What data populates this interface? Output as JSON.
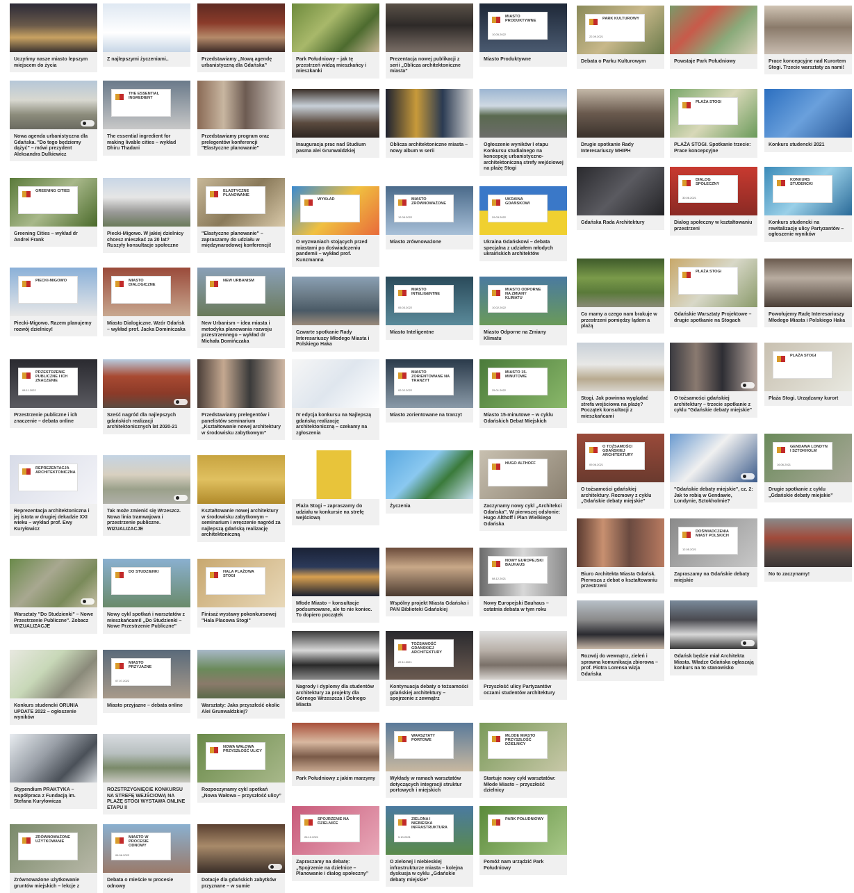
{
  "colors": {
    "card_bg": "#f0f0f0",
    "caption_text": "#2a2a2a",
    "accent_gold": "#d99c2b",
    "accent_red": "#c22a2a"
  },
  "cards": [
    {
      "caption": "Uczyńmy nasze miasto lepszym miejscem do życia",
      "thumb": "city-night"
    },
    {
      "caption": "Z najlepszymi życzeniami..",
      "thumb": "skyline-line"
    },
    {
      "caption": "Przedstawiamy „Nową agendę urbanistyczną dla Gdańska”",
      "thumb": "hall-red"
    },
    {
      "caption": "Park Południowy – jak tę przestrzeń widzą mieszkańcy i mieszkanki",
      "thumb": "greenery"
    },
    {
      "caption": "Prezentacja nowej publikacji z serii „Oblicza architektoniczne miasta”",
      "thumb": "audience"
    },
    {
      "caption": "Miasto Produktywne",
      "thumb": "badge-dark",
      "badge": "MIASTO PRODUKTYWNE",
      "date": "10.05.2022"
    },
    {
      "caption": "Debata o Parku Kulturowym",
      "thumb": "badge-aerial",
      "badge": "PARK KULTUROWY",
      "date": "22.09.2021"
    },
    {
      "caption": "Powstaje Park Południowy",
      "thumb": "map-red"
    },
    {
      "caption": "Prace koncepcyjne nad Kurortem Stogi. Trzecie warsztaty za nami!",
      "thumb": "workshop"
    },
    {
      "caption": "Nowa agenda urbanistyczna dla Gdańska. \"Do tego będziemy dążyć\" – mówi prezydent Aleksandra Dulkiewicz",
      "thumb": "street",
      "video": true
    },
    {
      "caption": "The essential ingredient for making livable cities – wykład Dhiru Thadani",
      "thumb": "badge-city",
      "badge": "THE ESSENTIAL INGREDIENT",
      "date": ""
    },
    {
      "caption": "Przedstawiamy program oraz prelegentów konferencji \"Elastyczne planowanie\"",
      "thumb": "portraits"
    },
    {
      "caption": "Inauguracja prac nad Studium pasma alei Grunwaldzkiej",
      "thumb": "presentation"
    },
    {
      "caption": "Oblicza architektoniczne miasta – nowy album w serii",
      "thumb": "books"
    },
    {
      "caption": "Ogłoszenie wyników I etapu Konkursu studialnego na koncepcję urbanistyczno-architektoniczną strefy wejściowej na plażę Stogi",
      "thumb": "road"
    },
    {
      "caption": "Drugie spotkanie Rady Interesariuszy MHIPH",
      "thumb": "meeting"
    },
    {
      "caption": "PLAŻA STOGI. Spotkanie trzecie: Prace koncepcyjne",
      "thumb": "badge-map",
      "badge": "PLAŻA STOGI",
      "date": ""
    },
    {
      "caption": "Konkurs studencki 2021",
      "thumb": "videocall-blue"
    },
    {
      "caption": "Greening Cities – wykład dr Andrei Frank",
      "thumb": "badge-trees",
      "badge": "GREENING CITIES",
      "date": ""
    },
    {
      "caption": "Piecki-Migowo. W jakiej dzielnicy chcesz mieszkać za 20 lat? Ruszyły konsultacje społeczne",
      "thumb": "blocks"
    },
    {
      "caption": "\"Elastyczne planowanie\" – zapraszamy do udziału w międzynarodowej konferencji!",
      "thumb": "badge-plan",
      "badge": "ELASTYCZNE PLANOWANIE",
      "date": ""
    },
    {
      "caption": "O wyzwaniach stojących przed miastami po doświadczeniu pandemii – wykład prof. Kunzmanna",
      "thumb": "badge-illustration",
      "badge": "WYKŁAD",
      "date": ""
    },
    {
      "caption": "Miasto zrównoważone",
      "thumb": "badge-hands",
      "badge": "MIASTO ZRÓWNOWAŻONE",
      "date": "12.05.2022"
    },
    {
      "caption": "Ukraina Gdańskowi – debata specjalna z udziałem młodych ukraińskich architektów",
      "thumb": "badge-ukraine",
      "badge": "UKRAINA GDAŃSKOWI",
      "date": "29.03.2022"
    },
    {
      "caption": "Gdańska Rada Architektury",
      "thumb": "videocall-dark"
    },
    {
      "caption": "Dialog społeczny w kształtowaniu przestrzeni",
      "thumb": "badge-red",
      "badge": "DIALOG SPOŁECZNY",
      "date": "30.06.2021"
    },
    {
      "caption": "Konkurs studencki na rewitalizację ulicy Partyzantów – ogłoszenie wyników",
      "thumb": "badge-blue-map",
      "badge": "KONKURS STUDENCKI",
      "date": ""
    },
    {
      "caption": "Piecki-Migowo. Razem planujemy rozwój dzielnicy!",
      "thumb": "badge-blocks",
      "badge": "PIECKI-MIGOWO",
      "date": ""
    },
    {
      "caption": "Miasto Dialogiczne. Wzór Gdańsk – wykład prof. Jacka Dominiczaka",
      "thumb": "badge-oldtown",
      "badge": "MIASTO DIALOGICZNE",
      "date": ""
    },
    {
      "caption": "New Urbanism – idea miasta i metodyka planowania rozwoju przestrzennego – wykład dr Michała Domińczaka",
      "thumb": "badge-harbour",
      "badge": "NEW URBANISM",
      "date": ""
    },
    {
      "caption": "Czwarte spotkanie Rady Interesariuszy Młodego Miasta i Polskiego Haka",
      "thumb": "harbour-aerial"
    },
    {
      "caption": "Miasto Inteligentne",
      "thumb": "badge-control",
      "badge": "MIASTO INTELIGENTNE",
      "date": "05.03.2022"
    },
    {
      "caption": "Miasto Odporne na Zmiany Klimatu",
      "thumb": "badge-river",
      "badge": "MIASTO ODPORNE NA ZMIANY KLIMATU",
      "date": "10.02.2022"
    },
    {
      "caption": "Co mamy a czego nam brakuje w przestrzeni pomiędzy lądem a plażą",
      "thumb": "walk"
    },
    {
      "caption": "Gdańskie Warsztaty Projektowe – drugie spotkanie na Stogach",
      "thumb": "badge-stogi",
      "badge": "PLAŻA STOGI",
      "date": ""
    },
    {
      "caption": "Powołujemy Radę Interesariuszy Młodego Miasta i Polskiego Haka",
      "thumb": "room"
    },
    {
      "caption": "Przestrzenie publiczne i ich znaczenie – debata online",
      "thumb": "badge-dark2",
      "badge": "PRZESTRZENIE PUBLICZNE I ICH ZNACZENIE",
      "date": "08.11.2022"
    },
    {
      "caption": "Sześć nagród dla najlepszych gdańskich realizacji architektonicznych lat 2020-21",
      "thumb": "red-brick",
      "video": true
    },
    {
      "caption": "Przedstawiamy prelegentów i panelistów seminarium „Kształtowanie nowej architektury w środowisku zabytkowym”",
      "thumb": "faces"
    },
    {
      "caption": "IV edycja konkursu na Najlepszą gdańską realizację architektoniczną – czekamy na zgłoszenia",
      "thumb": "award"
    },
    {
      "caption": "Miasto zorientowane na tranzyt",
      "thumb": "badge-station",
      "badge": "MIASTO ZORIENTOWANE NA TRANZYT",
      "date": "02.02.2022"
    },
    {
      "caption": "Miasto 15-minutowe – w cyklu Gdańskich Debat Miejskich",
      "thumb": "badge-green",
      "badge": "MIASTO 15-MINUTOWE",
      "date": "25.01.2022"
    },
    {
      "caption": "Stogi. Jak powinna wyglądać strefa wejściowa na plażę? Początek konsultacji z mieszkańcami",
      "thumb": "beach"
    },
    {
      "caption": "O tożsamości gdańskiej architektury – trzecie spotkanie z cyklu \"Gdańskie debaty miejskie\"",
      "thumb": "videocall-grid",
      "video": true
    },
    {
      "caption": "Plaża Stogi. Urządzamy kurort",
      "thumb": "badge-plaza",
      "badge": "PLAŻA STOGI",
      "date": ""
    },
    {
      "caption": "Reprezentacja architektoniczna i jej istota w drugiej dekadzie XXI wieku – wykład prof. Ewy Kuryłowicz",
      "thumb": "badge-white",
      "badge": "REPREZENTACJA ARCHITEKTONICZNA",
      "date": ""
    },
    {
      "caption": "Tak może zmienić się Wrzeszcz. Nowa linia tramwajowa i przestrzenie publiczne. WIZUALIZACJE",
      "thumb": "tram-street",
      "video": true
    },
    {
      "caption": "Kształtowanie nowej architektury w środowisku zabytkowym – seminarium i wręczenie nagród za najlepszą gdańską realizację architektoniczną",
      "thumb": "gold-poster"
    },
    {
      "caption": "Plaża Stogi – zapraszamy do udziału w konkursie na strefę wejściową",
      "thumb": "yellow-book"
    },
    {
      "caption": "Życzenia",
      "thumb": "xmas"
    },
    {
      "caption": "Zaczynamy nowy cykl „Architekci Gdańska”. W pierwszej odsłonie: Hugo Althoff i Plan Wielkiego Gdańska",
      "thumb": "badge-portrait",
      "badge": "HUGO ALTHOFF",
      "date": ""
    },
    {
      "caption": "O tożsamości gdańskiej architektury. Rozmowy z cyklu „Gdańskie debaty miejskie”",
      "thumb": "badge-brick",
      "badge": "O TOŻSAMOŚCI GDAŃSKIEJ ARCHITEKTURY",
      "date": "09.06.2021"
    },
    {
      "caption": "\"Gdańskie debaty miejskie\", cz. 2: Jak to robią w Gendawie, Londynie, Sztokholmie?",
      "thumb": "videocall-sky",
      "video": true
    },
    {
      "caption": "Drugie spotkanie z cyklu „Gdańskie debaty miejskie”",
      "thumb": "badge-aerial2",
      "badge": "GENDAWA LONDYN I SZTOKHOLM",
      "date": "16.06.2021"
    },
    {
      "caption": "Warsztaty \"Do Studzienki\" – Nowe Przestrzenie Publiczne\". Zobacz WIZUALIZACJE",
      "thumb": "green-aerial",
      "video": true
    },
    {
      "caption": "Nowy cykl spotkań i warsztatów z mieszkańcami! „Do Studzienki – Nowe Przestrzenie Publiczne”",
      "thumb": "badge-studzienki",
      "badge": "DO STUDZIENKI",
      "date": ""
    },
    {
      "caption": "Finisaż wystawy pokonkursowej \"Hala Placowa Stogi\"",
      "thumb": "badge-hala",
      "badge": "HALA PLAŻOWA STOGI",
      "date": ""
    },
    {
      "caption": "Młode Miasto – konsultacje podsumowane, ale to nie koniec. To dopiero początek",
      "thumb": "night-aerial"
    },
    {
      "caption": "Wspólny projekt Miasta Gdańska i PAN Biblioteki Gdańskiej",
      "thumb": "signing"
    },
    {
      "caption": "Nowy Europejski Bauhaus – ostatnia debata w tym roku",
      "thumb": "badge-collage",
      "badge": "NOWY EUROPEJSKI BAUHAUS",
      "date": "08.12.2021"
    },
    {
      "caption": "Biuro Architekta Miasta Gdańsk. Pierwsza z debat o kształtowaniu przestrzeni",
      "thumb": "faces-grid"
    },
    {
      "caption": "Zapraszamy na Gdańskie debaty miejskie",
      "thumb": "badge-grey",
      "badge": "DOŚWIADCZENIA MIAST POLSKICH",
      "date": "12.05.2021"
    },
    {
      "caption": "No to zaczynamy!",
      "thumb": "group-red"
    },
    {
      "caption": "Konkurs studencki ORUNIA UPDATE 2022 – ogłoszenie wyników",
      "thumb": "plan-3d"
    },
    {
      "caption": "Miasto przyjazne – debata online",
      "thumb": "badge-people",
      "badge": "MIASTO PRZYJAZNE",
      "date": "07.07.2022"
    },
    {
      "caption": "Warsztaty: Jaka przyszłość okolic Alei Grunwaldzkiej?",
      "thumb": "city-aerial"
    },
    {
      "caption": "Nagrody i dyplomy dla studentów architektury za projekty dla Górnego Wrzeszcza i Dolnego Miasta",
      "thumb": "diplomas"
    },
    {
      "caption": "Kontynuacja debaty o tożsamości gdańskiej architektury – spojrzenie z zewnątrz",
      "thumb": "badge-dark3",
      "badge": "TOŻSAMOŚĆ GDAŃSKIEJ ARCHITEKTURY",
      "date": "22.11.2021"
    },
    {
      "caption": "Przyszłość ulicy Partyzantów oczami studentów architektury",
      "thumb": "exhibition"
    },
    {
      "caption": "Rozwój do wewnątrz, zieleń i sprawna komunikacja zbiorowa – prof. Piotra Lorensa wizja Gdańska",
      "thumb": "man-city"
    },
    {
      "caption": "Gdańsk będzie miał Architekta Miasta. Władze Gdańska ogłaszają konkurs na to stanowisko",
      "thumb": "two-people",
      "video": true
    },
    {
      "caption": "Stypendium PRAKTYKA – współpraca z Fundacją im. Stefana Kuryłowicza",
      "thumb": "harbour-sketch"
    },
    {
      "caption": "ROZSTRZYGNIĘCIE KONKURSU NA STREFĘ WEJŚCIOWĄ NA PLAŻĘ STOGI WYSTAWA ONLINE ETAPU II",
      "thumb": "pavilion"
    },
    {
      "caption": "Rozpoczynamy cykl spotkań „Nowa Wałowa – przyszłość ulicy”",
      "thumb": "badge-walowa",
      "badge": "NOWA WAŁOWA PRZYSZŁOŚĆ ULICY",
      "date": ""
    },
    {
      "caption": "Park Południowy z jakim marzymy",
      "thumb": "workshop2"
    },
    {
      "caption": "Wykłady w ramach warsztatów dotyczących integracji struktur portowych i miejskich",
      "thumb": "badge-crane",
      "badge": "WARSZTATY PORTOWE",
      "date": ""
    },
    {
      "caption": "Startuje nowy cykl warsztatów: Młode Miasto – przyszłość dzielnicy",
      "thumb": "badge-mlode",
      "badge": "MŁODE MIASTO PRZYSZŁOŚĆ DZIELNICY",
      "date": ""
    },
    {
      "caption": "Zrównoważone użytkowanie gruntów miejskich – lekcje z",
      "thumb": "badge-aerial3",
      "badge": "ZRÓWNOWAŻONE UŻYTKOWANIE",
      "date": ""
    },
    {
      "caption": "Debata o mieście w procesie odnowy",
      "thumb": "badge-renewal",
      "badge": "MIASTO W PROCESIE ODNOWY",
      "date": "06.06.2022"
    },
    {
      "caption": "Dotacje dla gdańskich zabytków przyznane – w sumie",
      "thumb": "group-interior",
      "video": true
    },
    {
      "caption": "Zapraszamy na debatę: „Spojrzenie na dzielnice – Planowanie i dialog społeczny”",
      "thumb": "badge-pink",
      "badge": "SPOJRZENIE NA DZIELNICE",
      "date": "26.10.2021"
    },
    {
      "caption": "O zielonej i niebieskiej infrastrukturze miasta – kolejna dyskusja w cyklu „Gdańskie debaty miejskie”",
      "thumb": "badge-lake",
      "badge": "ZIELONA I NIEBIESKA INFRASTRUKTURA",
      "date": "5.10.2021"
    },
    {
      "caption": "Pomóż nam urządzić Park Południowy",
      "thumb": "badge-park",
      "badge": "PARK POŁUDNIOWY",
      "date": ""
    }
  ]
}
